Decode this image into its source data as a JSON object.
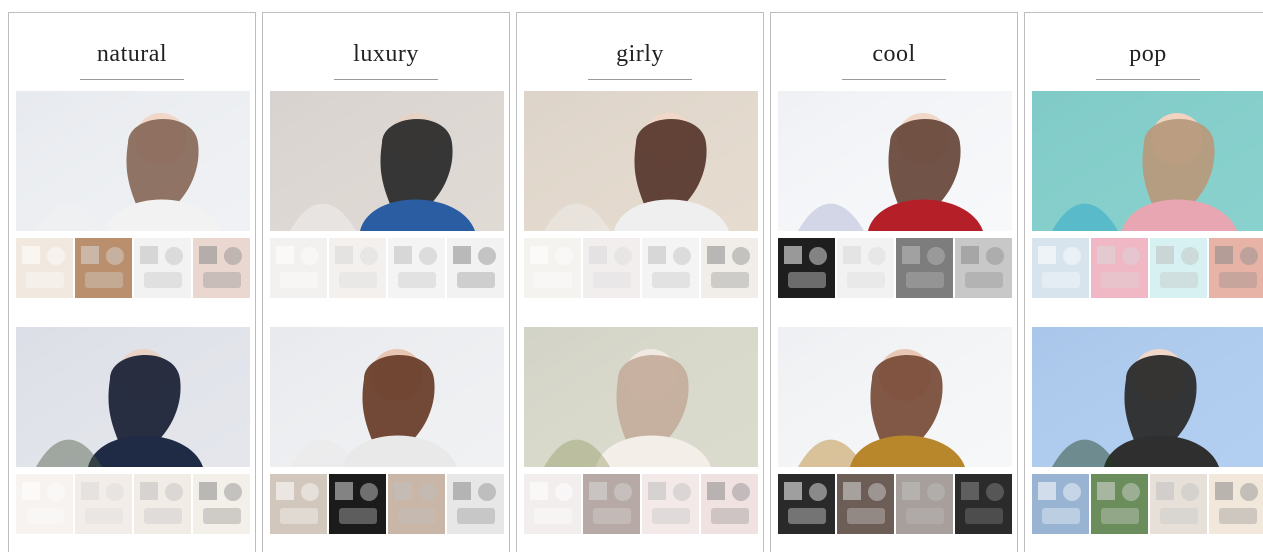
{
  "columns": [
    {
      "title": "natural",
      "hero1": {
        "bg": "#e7e9ee",
        "hair": "#8a6c5c",
        "skin": "#f0d7c8",
        "top": "#f2f2f2"
      },
      "hero2": {
        "bg": "#d6d9e2",
        "hair": "#1e2438",
        "skin": "#e9d3c6",
        "top": "#1f2a44",
        "accent": "#4f5b46"
      },
      "strip1": [
        "#f1e8df",
        "#b98f6e",
        "#f2f2f2",
        "#e9d7d0"
      ],
      "strip2": [
        "#f6f3f0",
        "#f3ede9",
        "#f1ece6",
        "#f3efe9"
      ]
    },
    {
      "title": "luxury",
      "hero1": {
        "bg": "#cfc6bf",
        "hair": "#2d2d2d",
        "skin": "#e6d3c5",
        "top": "#2b5da2",
        "accent": "#f3f3f3"
      },
      "hero2": {
        "bg": "#e8e9ec",
        "hair": "#6a3f2b",
        "skin": "#e8c6b3",
        "top": "#e9e9e9"
      },
      "strip1": [
        "#f3f1ef",
        "#f3f0ee",
        "#f4f4f4",
        "#f2f2f2"
      ],
      "strip2": [
        "#d2c7bc",
        "#1b1b1b",
        "#c9b6a6",
        "#e7e7e7"
      ]
    },
    {
      "title": "girly",
      "hero1": {
        "bg": "#d7c8b6",
        "hair": "#5a3a2f",
        "skin": "#f0d7c8",
        "top": "#efefef"
      },
      "hero2": {
        "bg": "#c7c8b2",
        "hair": "#c5ae9c",
        "skin": "#f1e9e1",
        "top": "#f4eee8",
        "accent": "#96a06b"
      },
      "strip1": [
        "#f5f3f0",
        "#f2eeee",
        "#f4f4f4",
        "#f1eeea"
      ],
      "strip2": [
        "#f3eeee",
        "#b7aaa6",
        "#f3e9e8",
        "#f1e2e2"
      ]
    },
    {
      "title": "cool",
      "hero1": {
        "bg": "#f3f4f7",
        "hair": "#6a4a3e",
        "skin": "#f0d7c8",
        "top": "#b51f28",
        "accent": "#aab0d0"
      },
      "hero2": {
        "bg": "#f1f2f4",
        "hair": "#7a4e3b",
        "skin": "#e9c7b6",
        "top": "#b8862b"
      },
      "strip1": [
        "#1e1e1e",
        "#f2f2f2",
        "#7d7d7d",
        "#c8c8c8"
      ],
      "strip2": [
        "#2a2a2a",
        "#6c5d57",
        "#a69f9c",
        "#2b2b2b"
      ]
    },
    {
      "title": "pop",
      "hero1": {
        "bg": "#48b8b2",
        "hair": "#b79a7d",
        "skin": "#f0d3c0",
        "top": "#e7a6b1",
        "accent": "#24a2c7"
      },
      "hero2": {
        "bg": "#89b4e8",
        "hair": "#2b2b2b",
        "skin": "#f0d7c8",
        "top": "#2f2f2f",
        "accent": "#1f3b1c"
      },
      "strip1": [
        "#d7e4ee",
        "#f0b7c5",
        "#d7f0f1",
        "#e7b3a6"
      ],
      "strip2": [
        "#99b4d2",
        "#6b8c5b",
        "#e7e0d9",
        "#f1e7da"
      ]
    }
  ]
}
